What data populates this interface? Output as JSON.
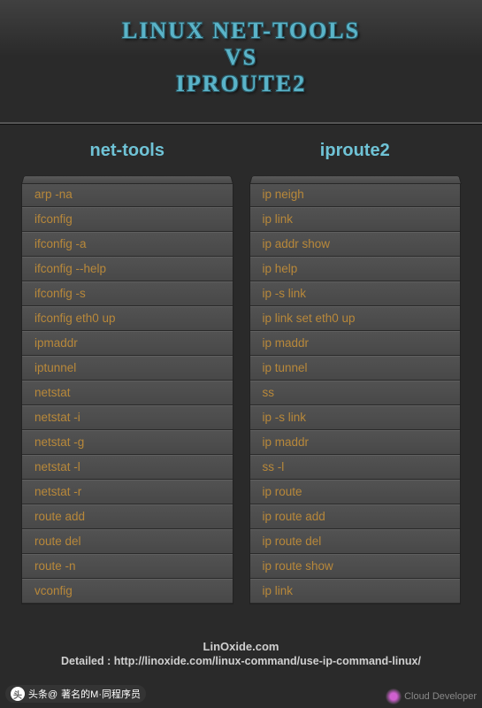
{
  "title": {
    "line1": "LINUX NET-TOOLS",
    "line2": "VS",
    "line3": "IPROUTE2"
  },
  "columns": {
    "left": {
      "header": "net-tools",
      "rows": [
        "arp -na",
        "ifconfig",
        "ifconfig -a",
        "ifconfig --help",
        "ifconfig -s",
        "ifconfig eth0 up",
        "ipmaddr",
        "iptunnel",
        "netstat",
        "netstat -i",
        "netstat  -g",
        "netstat -l",
        "netstat -r",
        "route add",
        "route del",
        "route -n",
        "vconfig"
      ]
    },
    "right": {
      "header": "iproute2",
      "rows": [
        "ip neigh",
        "ip link",
        "ip addr show",
        "ip help",
        "ip -s link",
        "ip link set eth0 up",
        "ip maddr",
        "ip tunnel",
        "ss",
        "ip -s link",
        "ip maddr",
        "ss -l",
        "ip route",
        "ip route add",
        "ip route del",
        "ip route show",
        "ip link"
      ]
    }
  },
  "footer": {
    "site": "LinOxide.com",
    "detail": "Detailed : http://linoxide.com/linux-command/use-ip-command-linux/"
  },
  "watermark": {
    "left_prefix": "头条@",
    "left_text": "著名的M·同程序员",
    "right_text": "Cloud Developer"
  }
}
